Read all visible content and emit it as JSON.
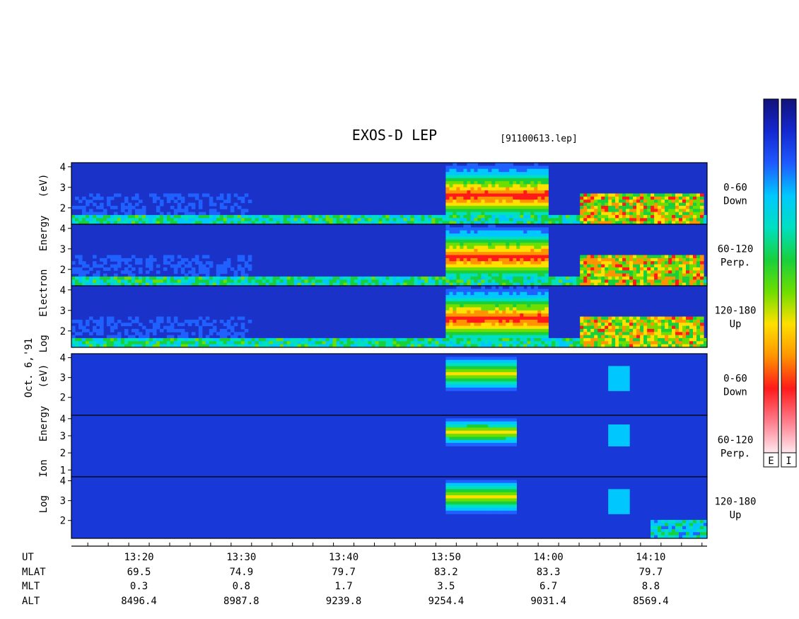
{
  "title": "EXOS-D LEP",
  "file": "[91100613.lep]",
  "date_label": "Oct. 6,'91",
  "electron_ylabel": "Log   Electron   Energy   (eV)",
  "ion_ylabel": "Log   Ion   Energy   (eV)",
  "colorbar": {
    "labels": [
      "E",
      "I"
    ],
    "colors": [
      "#12127a",
      "#1428d0",
      "#1e5aff",
      "#00c8ff",
      "#00e0c0",
      "#18d03c",
      "#6ede00",
      "#ffe000",
      "#ff9400",
      "#ff1a1a",
      "#ff7a8a",
      "#ffe8ee"
    ]
  },
  "chart_data": {
    "type": "heatmap",
    "xlabel": "UT",
    "x_range_ut": [
      "13:15",
      "14:15"
    ],
    "panels": [
      {
        "species": "Electron",
        "label": [
          "0-60",
          "Down"
        ],
        "yticks": [
          "4",
          "3",
          "2"
        ],
        "ylim": [
          1.2,
          4.2
        ],
        "hot_features": [
          {
            "kind": "band",
            "t0": "13:50",
            "t1": "14:00",
            "level": 2.6
          },
          {
            "kind": "patches",
            "t0": "14:03",
            "t1": "14:15",
            "level": 2.1
          }
        ]
      },
      {
        "species": "Electron",
        "label": [
          "60-120",
          "Perp."
        ],
        "yticks": [
          "4",
          "3",
          "2"
        ],
        "ylim": [
          1.2,
          4.2
        ],
        "hot_features": [
          {
            "kind": "band",
            "t0": "13:50",
            "t1": "14:00",
            "level": 2.6
          },
          {
            "kind": "patches",
            "t0": "14:03",
            "t1": "14:15",
            "level": 2.1
          }
        ]
      },
      {
        "species": "Electron",
        "label": [
          "120-180",
          "Up"
        ],
        "yticks": [
          "4",
          "3",
          "2"
        ],
        "ylim": [
          1.2,
          4.2
        ],
        "hot_features": [
          {
            "kind": "band",
            "t0": "13:50",
            "t1": "14:00",
            "level": 2.6
          },
          {
            "kind": "patches",
            "t0": "14:03",
            "t1": "14:15",
            "level": 2.1
          }
        ]
      },
      {
        "species": "Ion",
        "label": [
          "0-60",
          "Down"
        ],
        "yticks": [
          "4",
          "3",
          "2"
        ],
        "ylim": [
          1.1,
          4.2
        ],
        "hot_features": [
          {
            "kind": "band",
            "t0": "13:50",
            "t1": "13:57",
            "level": 3.2
          },
          {
            "kind": "spot",
            "t": "14:07",
            "level": 3.0
          }
        ]
      },
      {
        "species": "Ion",
        "label": [
          "60-120",
          "Perp."
        ],
        "yticks": [
          "4",
          "3",
          "2",
          "1"
        ],
        "ylim": [
          0.6,
          4.2
        ],
        "hot_features": [
          {
            "kind": "band",
            "t0": "13:50",
            "t1": "13:57",
            "level": 3.2
          },
          {
            "kind": "spot",
            "t": "14:07",
            "level": 3.0
          }
        ]
      },
      {
        "species": "Ion",
        "label": [
          "120-180",
          "Up"
        ],
        "yticks": [
          "4",
          "3",
          "2"
        ],
        "ylim": [
          1.1,
          4.2
        ],
        "hot_features": [
          {
            "kind": "band",
            "t0": "13:50",
            "t1": "13:57",
            "level": 3.2
          },
          {
            "kind": "spot",
            "t": "14:07",
            "level": 3.0
          }
        ]
      }
    ],
    "ephemeris": {
      "row_labels": [
        "UT",
        "MLAT",
        "MLT",
        "ALT"
      ],
      "columns": [
        {
          "UT": "13:20",
          "MLAT": "69.5",
          "MLT": "0.3",
          "ALT": "8496.4"
        },
        {
          "UT": "13:30",
          "MLAT": "74.9",
          "MLT": "0.8",
          "ALT": "8987.8"
        },
        {
          "UT": "13:40",
          "MLAT": "79.7",
          "MLT": "1.7",
          "ALT": "9239.8"
        },
        {
          "UT": "13:50",
          "MLAT": "83.2",
          "MLT": "3.5",
          "ALT": "9254.4"
        },
        {
          "UT": "14:00",
          "MLAT": "83.3",
          "MLT": "6.7",
          "ALT": "9031.4"
        },
        {
          "UT": "14:10",
          "MLAT": "79.7",
          "MLT": "8.8",
          "ALT": "8569.4"
        }
      ]
    }
  }
}
